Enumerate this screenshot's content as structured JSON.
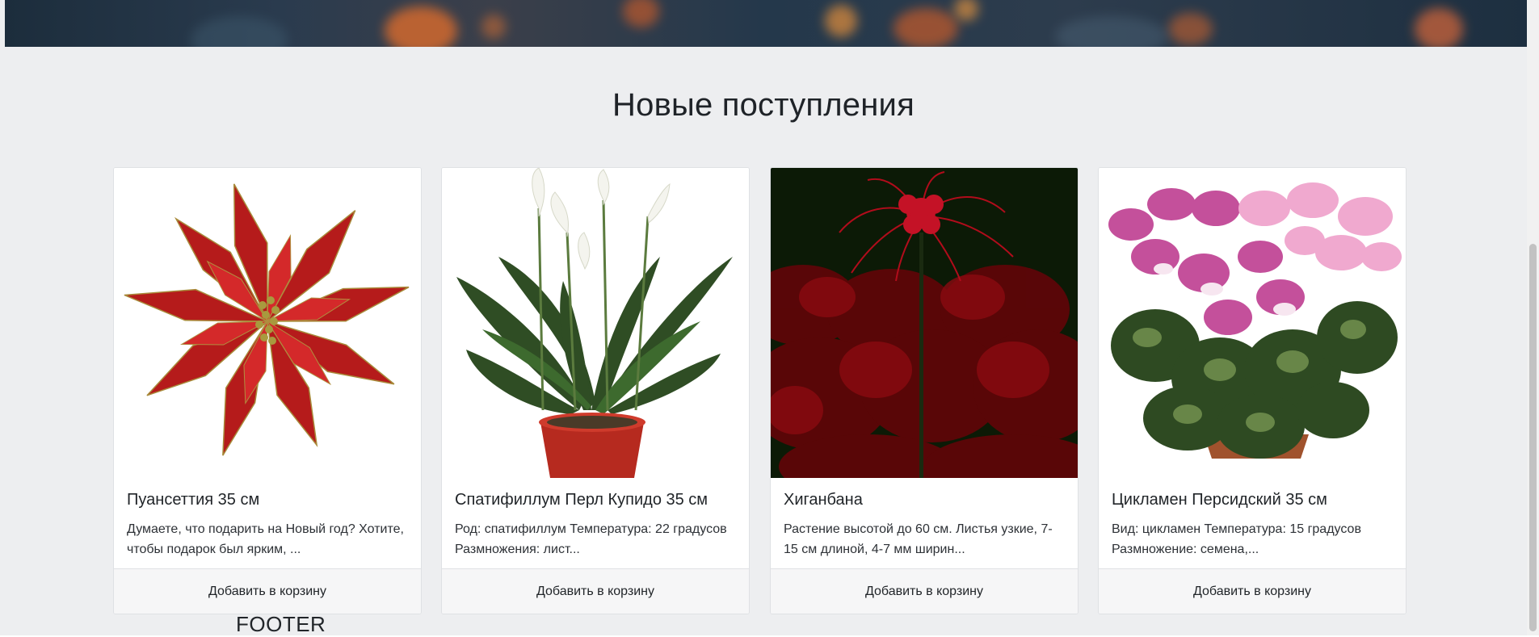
{
  "section": {
    "title": "Новые поступления"
  },
  "products": [
    {
      "name": "Пуансеттия 35 см",
      "description": "Думаете, что подарить на Новый год? Хотите, чтобы подарок был ярким, ...",
      "add_label": "Добавить в корзину",
      "image_icon": "poinsettia-image"
    },
    {
      "name": "Спатифиллум Перл Купидо 35 см",
      "description": "Род: спатифиллум Температура: 22 градусов Размножения: лист...",
      "add_label": "Добавить в корзину",
      "image_icon": "spathiphyllum-image"
    },
    {
      "name": "Хиганбана",
      "description": "Растение высотой до 60 см. Листья узкие, 7-15 см длиной, 4-7 мм ширин...",
      "add_label": "Добавить в корзину",
      "image_icon": "higanbana-image"
    },
    {
      "name": "Цикламен Персидский 35 см",
      "description": "Вид: цикламен Температура: 15 градусов Размножение: семена,...",
      "add_label": "Добавить в корзину",
      "image_icon": "cyclamen-image"
    }
  ],
  "footer": {
    "label": "FOOTER"
  },
  "colors": {
    "page_background": "#edeef0",
    "card_background": "#ffffff",
    "button_background": "#f6f6f7",
    "poinsettia_red": "#c8201f",
    "higanbana_background": "#0c1a06"
  }
}
